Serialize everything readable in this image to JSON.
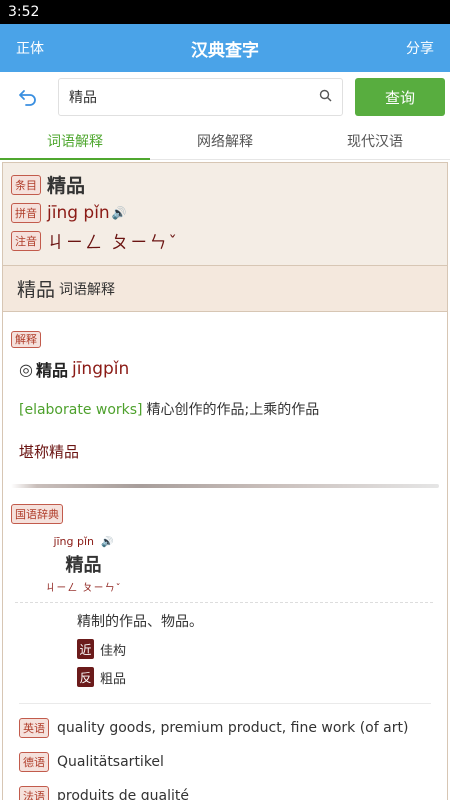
{
  "status_bar": {
    "time": "3:52"
  },
  "app_bar": {
    "left": "正体",
    "title": "汉典查字",
    "right": "分享"
  },
  "search": {
    "value": "精品",
    "button": "查询"
  },
  "tabs": [
    {
      "label": "词语解释"
    },
    {
      "label": "网络解释"
    },
    {
      "label": "现代汉语"
    }
  ],
  "entry": {
    "tag_entry": "条目",
    "word": "精品",
    "tag_pinyin": "拼音",
    "pinyin": "jīng pǐn",
    "tag_zhuyin": "注音",
    "zhuyin": "ㄐㄧㄥ ㄆㄧㄣˇ"
  },
  "section": {
    "big": "精品",
    "small": "词语解释"
  },
  "explain": {
    "tag": "解释",
    "marker": "◎",
    "word": "精品",
    "pinyin": "jīngpǐn",
    "english": "[elaborate works]",
    "definition": "精心创作的作品;上乘的作品",
    "example": "堪称精品"
  },
  "guoyu": {
    "tag": "国语辞典",
    "pinyin": "jīng pǐn",
    "word": "精品",
    "zhuyin": "ㄐㄧㄥ ㄆㄧㄣˇ",
    "definition": "精制的作品、物品。",
    "synonym_badge": "近",
    "synonym": "佳构",
    "antonym_badge": "反",
    "antonym": "粗品"
  },
  "translations": [
    {
      "tag": "英语",
      "text": "quality goods, premium product, fine work (of art)"
    },
    {
      "tag": "德语",
      "text": "Qualitätsartikel"
    },
    {
      "tag": "法语",
      "text": "produits de qualité"
    }
  ]
}
